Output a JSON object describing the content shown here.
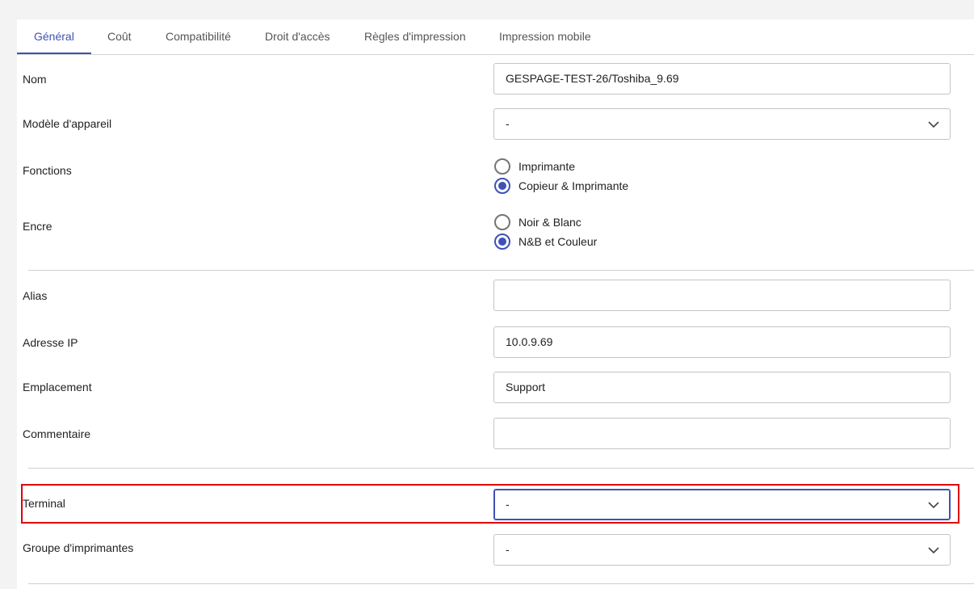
{
  "tabs": [
    {
      "label": "Général",
      "active": true
    },
    {
      "label": "Coût"
    },
    {
      "label": "Compatibilité"
    },
    {
      "label": "Droit d'accès"
    },
    {
      "label": "Règles d'impression"
    },
    {
      "label": "Impression mobile"
    }
  ],
  "form": {
    "nom": {
      "label": "Nom",
      "value": "GESPAGE-TEST-26/Toshiba_9.69"
    },
    "modele": {
      "label": "Modèle d'appareil",
      "value": "-"
    },
    "fonctions": {
      "label": "Fonctions",
      "options": [
        {
          "label": "Imprimante",
          "checked": false
        },
        {
          "label": "Copieur & Imprimante",
          "checked": true
        }
      ]
    },
    "encre": {
      "label": "Encre",
      "options": [
        {
          "label": "Noir & Blanc",
          "checked": false
        },
        {
          "label": "N&B et Couleur",
          "checked": true
        }
      ]
    },
    "alias": {
      "label": "Alias",
      "value": ""
    },
    "adresse_ip": {
      "label": "Adresse IP",
      "value": "10.0.9.69"
    },
    "emplacement": {
      "label": "Emplacement",
      "value": "Support"
    },
    "commentaire": {
      "label": "Commentaire",
      "value": ""
    },
    "terminal": {
      "label": "Terminal",
      "value": "-"
    },
    "groupe": {
      "label": "Groupe d'imprimantes",
      "value": "-"
    }
  },
  "colors": {
    "accent": "#3f51b5",
    "highlight": "#e0000b"
  },
  "icons": {
    "select_arrow": "chevron-down-icon"
  }
}
